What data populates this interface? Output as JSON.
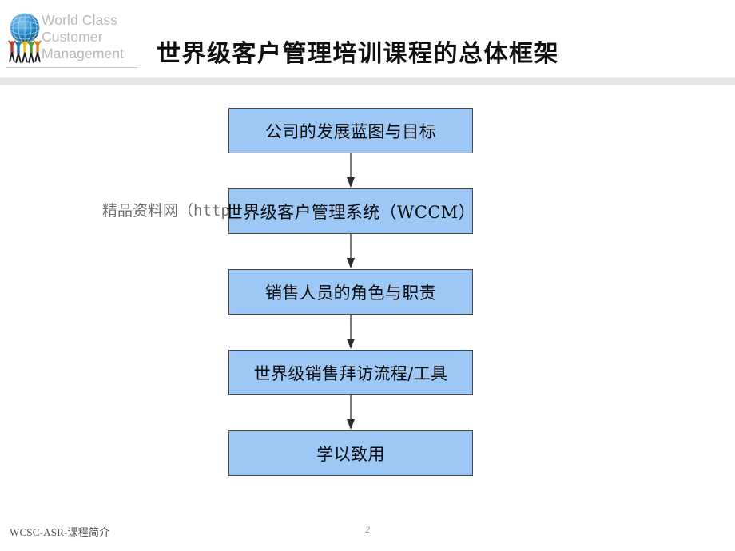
{
  "slide": {
    "title": "世界级客户管理培训课程的总体框架",
    "background_color": "#ffffff"
  },
  "logo": {
    "icon_name": "world-class-customer-management-globe-logo",
    "line1": "World Class",
    "line2": "Customer",
    "line3": "Management",
    "text_color": "#b9b9b9",
    "globe_color": "#1f7fc6"
  },
  "watermark": {
    "text": "精品资料网（http://",
    "color": "#6d6d6d"
  },
  "flowchart": {
    "type": "vertical-flow",
    "box_fill": "#9DC8F5",
    "box_border": "#4a4a4a",
    "arrow_color": "#595959",
    "steps": [
      {
        "label": "公司的发展蓝图与目标"
      },
      {
        "label": "世界级客户管理系统（WCCM）"
      },
      {
        "label": "销售人员的角色与职责"
      },
      {
        "label": "世界级销售拜访流程/工具"
      },
      {
        "label": "学以致用"
      }
    ]
  },
  "footer": {
    "left_text": "WCSC-ASR-课程简介",
    "page_number": "2"
  }
}
